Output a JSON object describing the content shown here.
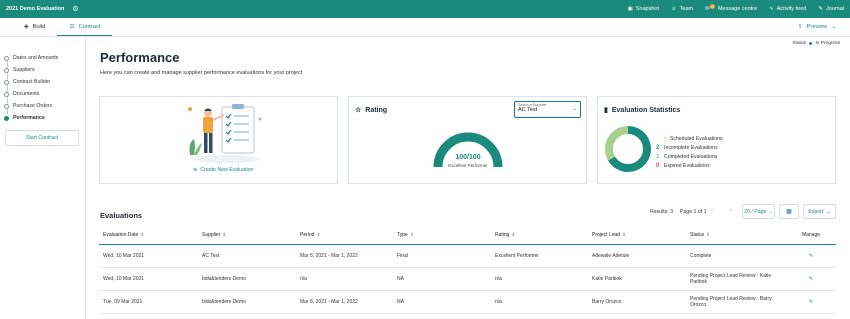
{
  "topbar": {
    "project": "2021 Demo Evaluation",
    "items": [
      {
        "icon": "camera-icon",
        "label": "Snapshot"
      },
      {
        "icon": "team-icon",
        "label": "Team"
      },
      {
        "icon": "message-icon",
        "label": "Message centre",
        "badge": "8"
      },
      {
        "icon": "activity-icon",
        "label": "Activity feed"
      },
      {
        "icon": "journal-icon",
        "label": "Journal"
      }
    ]
  },
  "tabs": [
    {
      "label": "Build",
      "icon": "layers-icon"
    },
    {
      "label": "Contract",
      "icon": "contract-icon"
    }
  ],
  "preview": "Preview",
  "status": {
    "label": "Status",
    "value": "In Progress"
  },
  "sidebar": {
    "steps": [
      "Dates and Amounts",
      "Suppliers",
      "Contract Builder",
      "Documents",
      "Purchase Orders",
      "Performance"
    ],
    "active_index": 5,
    "start_button": "Start Contract"
  },
  "page": {
    "title": "Performance",
    "subtitle": "Here you can create and manage supplier performance evaluations for your project"
  },
  "create_card": {
    "link": "Create New Evaluation"
  },
  "rating_card": {
    "title": "Rating",
    "select_label": "Select a Supplier",
    "select_value": "AC Test",
    "score": "100/100",
    "score_label": "Excellent Performer",
    "gauge_fraction": 1.0,
    "gauge_color": "#1a8a7f"
  },
  "stats_card": {
    "title": "Evaluation Statistics",
    "items": [
      {
        "count": "",
        "label": "Scheduled Evaluations",
        "color": "#e8a33a"
      },
      {
        "count": "2",
        "label": "Incomplete Evaluations",
        "color": "#1a8a7f"
      },
      {
        "count": "1",
        "label": "Completed Evaluations",
        "color": "#a8d08d"
      },
      {
        "count": "0",
        "label": "Expired Evaluations",
        "color": "#d9534f"
      }
    ]
  },
  "evaluations": {
    "title": "Evaluations",
    "results": "Results: 3",
    "page_of": "Page 1 of 1",
    "per_page": "20 / Page",
    "export": "Export",
    "columns": [
      "Evaluation Date",
      "Supplier",
      "Period",
      "Type",
      "Rating",
      "Project Lead",
      "Status",
      "Manage"
    ],
    "rows": [
      {
        "date": "Wed, 10 Mar 2021",
        "supplier": "AC Test",
        "period": "Mar 8, 2021 - Mar 1, 2022",
        "type": "Final",
        "rating": "Excellent Performer",
        "lead": "Adewale Adetule",
        "status": "Complete"
      },
      {
        "date": "Wed, 10 Mar 2021",
        "supplier": "bids&tenders Demo",
        "period": "n/a",
        "type": "NA",
        "rating": "n/a",
        "lead": "Katie Paribok",
        "status": "Pending Project Lead Review : Katie Paribok"
      },
      {
        "date": "Tue, 09 Mar 2021",
        "supplier": "bids&tenders Demo",
        "period": "Mar 8, 2021 - Mar 1, 2022",
        "type": "NA",
        "rating": "n/a",
        "lead": "Barry Orozco",
        "status": "Pending Project Lead Review : Barry Orozco"
      }
    ]
  }
}
